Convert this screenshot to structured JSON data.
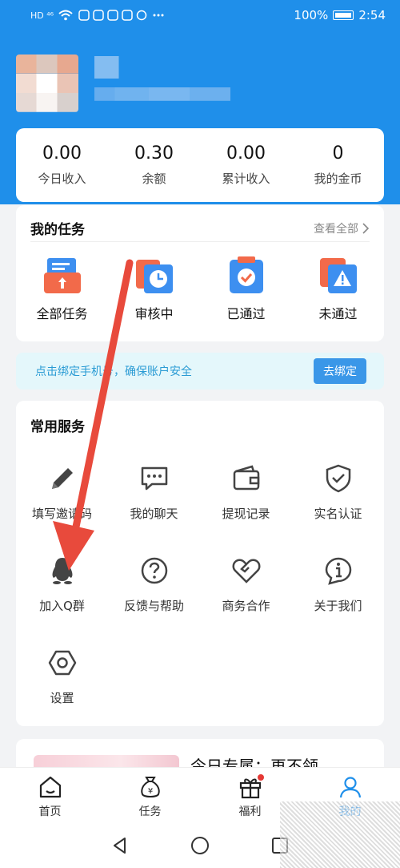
{
  "status_bar": {
    "left_indicators": "HD ⁴⁶",
    "battery": "100%",
    "time": "2:54"
  },
  "stats": [
    {
      "value": "0.00",
      "label": "今日收入"
    },
    {
      "value": "0.30",
      "label": "余额"
    },
    {
      "value": "0.00",
      "label": "累计收入"
    },
    {
      "value": "0",
      "label": "我的金币"
    }
  ],
  "tasks": {
    "title": "我的任务",
    "view_all": "查看全部",
    "items": [
      {
        "label": "全部任务",
        "icon": "all-tasks-icon"
      },
      {
        "label": "审核中",
        "icon": "clock-icon"
      },
      {
        "label": "已通过",
        "icon": "check-icon"
      },
      {
        "label": "未通过",
        "icon": "warning-icon"
      }
    ]
  },
  "bind_banner": {
    "text": "点击绑定手机号，确保账户安全",
    "button": "去绑定"
  },
  "services": {
    "title": "常用服务",
    "items": [
      {
        "label": "填写邀请码",
        "icon": "pencil-icon"
      },
      {
        "label": "我的聊天",
        "icon": "chat-icon"
      },
      {
        "label": "提现记录",
        "icon": "wallet-icon"
      },
      {
        "label": "实名认证",
        "icon": "shield-icon"
      },
      {
        "label": "加入Q群",
        "icon": "penguin-icon"
      },
      {
        "label": "反馈与帮助",
        "icon": "question-icon"
      },
      {
        "label": "商务合作",
        "icon": "handshake-icon"
      },
      {
        "label": "关于我们",
        "icon": "info-icon"
      },
      {
        "label": "设置",
        "icon": "gear-icon"
      }
    ]
  },
  "promo": {
    "text": "今日专属：再不领"
  },
  "tab_bar": [
    {
      "label": "首页",
      "icon": "home-icon"
    },
    {
      "label": "任务",
      "icon": "money-bag-icon"
    },
    {
      "label": "福利",
      "icon": "gift-icon"
    },
    {
      "label": "我的",
      "icon": "user-icon",
      "active": true
    }
  ],
  "colors": {
    "primary": "#1f8fea",
    "annotation_arrow": "#e84a3c"
  }
}
